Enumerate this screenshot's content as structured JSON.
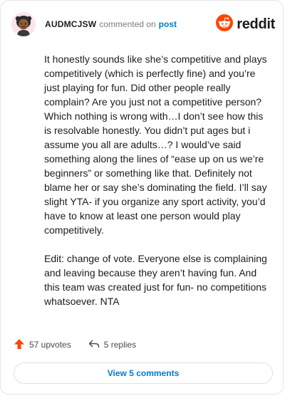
{
  "header": {
    "username": "AUDMCJSW",
    "action_text": "commented on",
    "post_link": "post",
    "brand": "reddit"
  },
  "comment": {
    "paragraphs": [
      "It honestly sounds like she’s competitive and plays competitively (which is perfectly fine) and you’re just playing for fun. Did other people really complain? Are you just not a competitive person? Which nothing is wrong with…I don’t see how this is resolvable honestly. You didn’t put ages but i assume you all are adults…? I would’ve said something along the lines of “ease up on us we’re beginners” or something like that. Definitely not blame her or say she’s dominating the field. I’ll say slight YTA- if you organize any sport activity, you’d have to know at least one person would play competitively.",
      "Edit: change of vote. Everyone else is complaining and leaving because they aren’t having fun. And this team was created just for fun- no competitions whatsoever. NTA"
    ]
  },
  "actions": {
    "upvotes": "57 upvotes",
    "replies": "5 replies"
  },
  "footer": {
    "view_comments": "View 5 comments"
  },
  "colors": {
    "reddit_orange": "#ff4500",
    "link_blue": "#0079d3",
    "upvote": "#ff4500"
  },
  "icons": {
    "avatar": "avatar",
    "brand": "reddit-logo-icon",
    "upvote": "upvote-arrow-icon",
    "reply": "reply-arrow-icon"
  }
}
